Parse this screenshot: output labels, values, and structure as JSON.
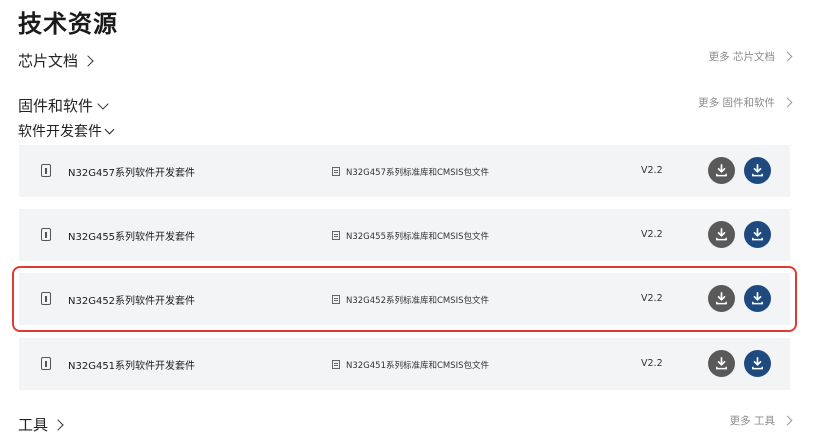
{
  "page": {
    "title": "技术资源"
  },
  "sections": {
    "chip_docs": {
      "label": "芯片文档",
      "more": "更多 芯片文档"
    },
    "firmware": {
      "label": "固件和软件",
      "more": "更多 固件和软件"
    },
    "sdk": {
      "label": "软件开发套件"
    },
    "tools": {
      "label": "工具",
      "more": "更多 工具"
    }
  },
  "rows": [
    {
      "name": "N32G457系列软件开发套件",
      "doc": "N32G457系列标准库和CMSIS包文件",
      "version": "V2.2"
    },
    {
      "name": "N32G455系列软件开发套件",
      "doc": "N32G455系列标准库和CMSIS包文件",
      "version": "V2.2"
    },
    {
      "name": "N32G452系列软件开发套件",
      "doc": "N32G452系列标准库和CMSIS包文件",
      "version": "V2.2"
    },
    {
      "name": "N32G451系列软件开发套件",
      "doc": "N32G451系列标准库和CMSIS包文件",
      "version": "V2.2"
    }
  ],
  "colors": {
    "highlight": "#e03b33",
    "download_primary": "#1f4a80",
    "download_secondary": "#595959",
    "row_bg": "#f3f4f6"
  },
  "icons": {
    "row_file": "file-icon",
    "row_doc": "document-icon",
    "download": "download-icon"
  }
}
